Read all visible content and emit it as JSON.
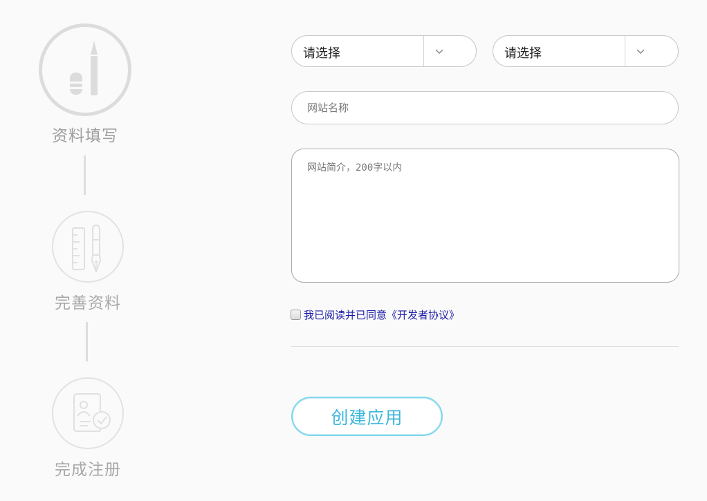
{
  "steps": [
    {
      "label": "资料填写",
      "icon": "pencil-eraser-icon",
      "state": "active"
    },
    {
      "label": "完善资料",
      "icon": "ruler-pen-icon",
      "state": "pending"
    },
    {
      "label": "完成注册",
      "icon": "document-check-icon",
      "state": "pending"
    }
  ],
  "form": {
    "select_a": {
      "value": "请选择"
    },
    "select_b": {
      "value": "请选择"
    },
    "site_name": {
      "value": "",
      "placeholder": "网站名称"
    },
    "site_intro": {
      "value": "",
      "placeholder": "网站简介，200字以内"
    },
    "agreement": {
      "checked": false,
      "text": "我已阅读并已同意《开发者协议》"
    },
    "submit_label": "创建应用"
  },
  "colors": {
    "background": "#fafafa",
    "step_gray": "#a8a8a8",
    "accent": "#3fb7db",
    "link": "#1a1aa6"
  }
}
